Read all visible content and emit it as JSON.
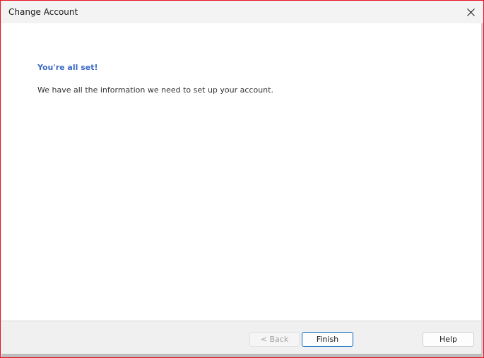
{
  "window": {
    "title": "Change Account"
  },
  "main": {
    "heading": "You're all set!",
    "message": "We have all the information we need to set up your account."
  },
  "footer": {
    "back_label": "< Back",
    "finish_label": "Finish",
    "help_label": "Help"
  },
  "colors": {
    "heading": "#3c6ac4",
    "frame": "#e81123",
    "primary_button_border": "#0067c0"
  }
}
